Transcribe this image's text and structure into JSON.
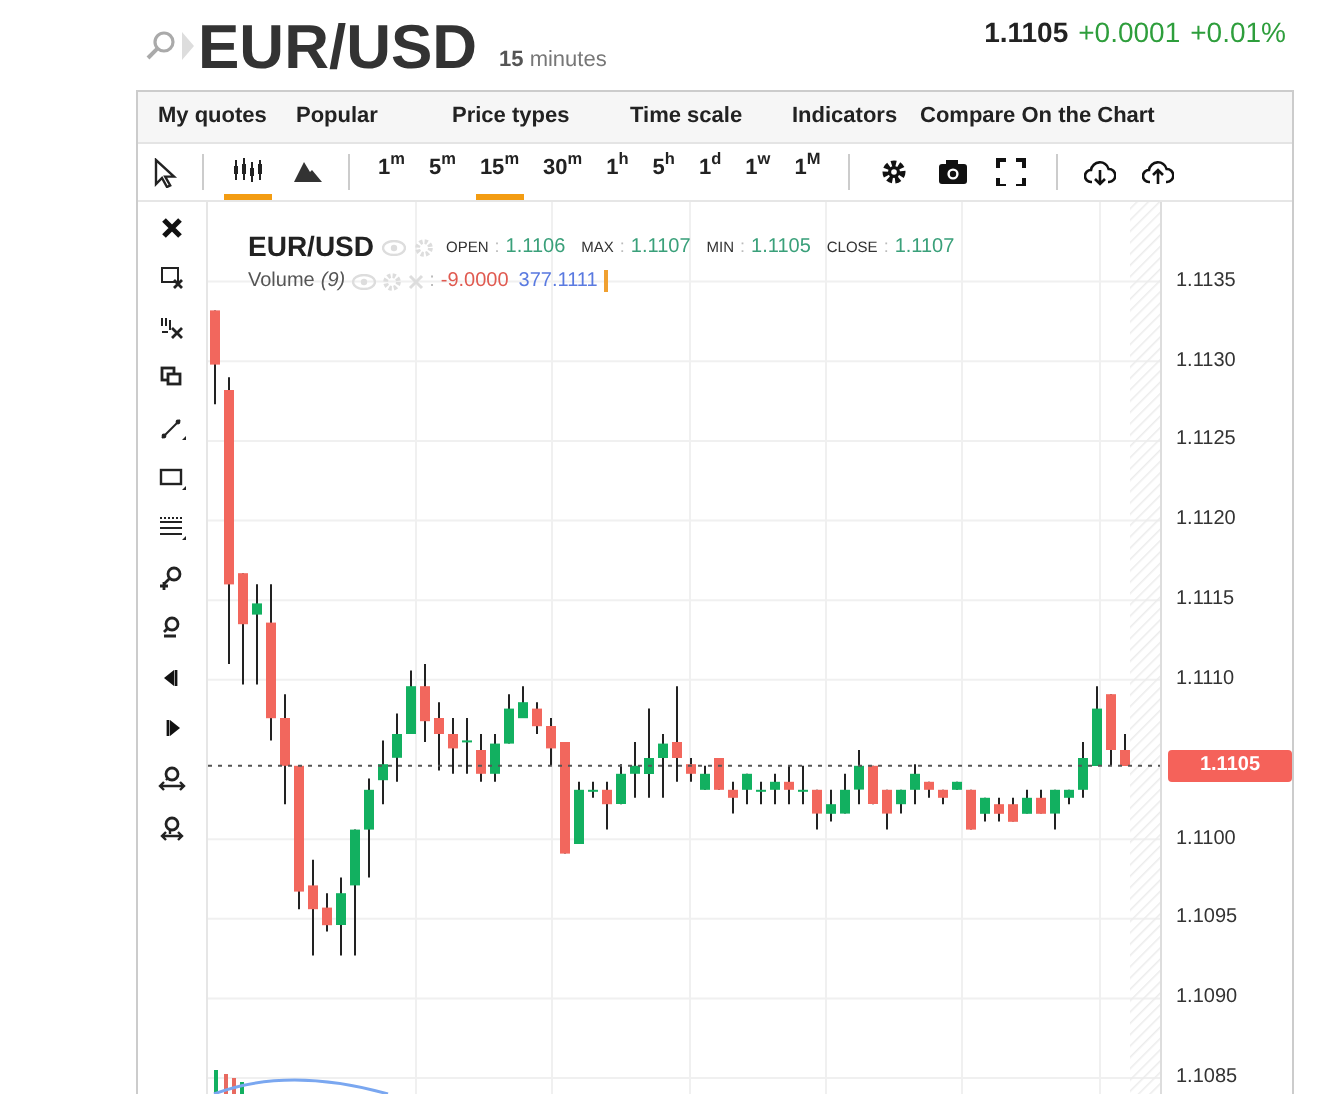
{
  "header": {
    "symbol": "EUR/USD",
    "interval_number": "15",
    "interval_unit": "minutes",
    "price": "1.1105",
    "change": "+0.0001",
    "change_percent": "+0.01%"
  },
  "menu": [
    "My quotes",
    "Popular",
    "Price types",
    "Time scale",
    "Indicators",
    "Compare On the Chart"
  ],
  "chart_types": [
    {
      "kind": "candles",
      "selected": true
    },
    {
      "kind": "area",
      "selected": false
    }
  ],
  "timeframes": [
    {
      "number": "1",
      "unit": "m",
      "selected": false
    },
    {
      "number": "5",
      "unit": "m",
      "selected": false
    },
    {
      "number": "15",
      "unit": "m",
      "selected": true
    },
    {
      "number": "30",
      "unit": "m",
      "selected": false
    },
    {
      "number": "1",
      "unit": "h",
      "selected": false
    },
    {
      "number": "5",
      "unit": "h",
      "selected": false
    },
    {
      "number": "1",
      "unit": "d",
      "selected": false
    },
    {
      "number": "1",
      "unit": "w",
      "selected": false
    },
    {
      "number": "1",
      "unit": "M",
      "selected": false
    }
  ],
  "legend": {
    "symbol": "EUR/USD",
    "fields": [
      {
        "label": "OPEN",
        "separator": ":",
        "value": "1.1106"
      },
      {
        "label": "MAX",
        "separator": ":",
        "value": "1.1107"
      },
      {
        "label": "MIN",
        "separator": ":",
        "value": "1.1105"
      },
      {
        "label": "CLOSE",
        "separator": ":",
        "value": "1.1107"
      }
    ],
    "volume": {
      "label": "Volume",
      "parameter": "(9)",
      "separator": ":",
      "value": "-9.0000",
      "value_2": "377.1111"
    }
  },
  "price_label": "1.1105",
  "chart_data": {
    "type": "candlestick",
    "ylim": [
      1.1084,
      1.114
    ],
    "yticks": [
      {
        "value": 1.1135,
        "label": "1.1135"
      },
      {
        "value": 1.113,
        "label": "1.1130"
      },
      {
        "value": 1.1125,
        "label": "1.1125"
      },
      {
        "value": 1.112,
        "label": "1.1120"
      },
      {
        "value": 1.1115,
        "label": "1.1115"
      },
      {
        "value": 1.111,
        "label": "1.1110"
      },
      {
        "value": 1.11,
        "label": "1.1100"
      },
      {
        "value": 1.1095,
        "label": "1.1095"
      },
      {
        "value": 1.109,
        "label": "1.1090"
      },
      {
        "value": 1.1085,
        "label": "1.1085"
      }
    ],
    "grid": true,
    "categories": [
      null,
      null,
      null,
      null,
      null,
      null,
      null,
      null,
      null,
      null,
      null,
      null,
      null,
      null,
      null,
      null,
      null,
      null,
      null,
      null,
      null,
      null,
      null,
      null,
      null,
      null,
      null,
      null,
      null,
      null,
      null,
      null,
      null,
      null,
      null,
      null,
      null,
      null,
      null,
      null,
      null,
      null,
      null,
      null,
      null,
      null,
      null,
      null,
      null,
      null,
      null,
      null,
      null,
      null,
      null,
      null,
      null,
      null,
      null,
      null,
      null,
      null,
      null,
      null,
      null,
      null
    ],
    "series": [
      {
        "ohlc": [
          [
            1.11332,
            1.11332,
            1.11273,
            1.11298
          ],
          [
            1.11282,
            1.1129,
            1.1111,
            1.1116
          ],
          [
            1.11167,
            1.11167,
            1.11097,
            1.11135
          ],
          [
            1.11141,
            1.1116,
            1.11097,
            1.11148
          ],
          [
            1.11136,
            1.1116,
            1.11062,
            1.11076
          ],
          [
            1.11076,
            1.11091,
            1.11022,
            1.11046
          ],
          [
            1.11046,
            1.11046,
            1.10956,
            1.10967
          ],
          [
            1.10971,
            1.10987,
            1.10927,
            1.10956
          ],
          [
            1.10957,
            1.10966,
            1.10942,
            1.10946
          ],
          [
            1.10946,
            1.10976,
            1.10927,
            1.10966
          ],
          [
            1.10971,
            1.11006,
            1.10927,
            1.11006
          ],
          [
            1.11006,
            1.11038,
            1.10976,
            1.11031
          ],
          [
            1.11037,
            1.11062,
            1.11022,
            1.11047
          ],
          [
            1.11051,
            1.11079,
            1.11036,
            1.11066
          ],
          [
            1.11066,
            1.11106,
            1.11066,
            1.11096
          ],
          [
            1.11096,
            1.1111,
            1.11061,
            1.11074
          ],
          [
            1.11076,
            1.11086,
            1.11043,
            1.11066
          ],
          [
            1.11066,
            1.11076,
            1.11041,
            1.11057
          ],
          [
            1.11062,
            1.11076,
            1.11041,
            1.11062
          ],
          [
            1.11056,
            1.11066,
            1.11036,
            1.11041
          ],
          [
            1.11041,
            1.11066,
            1.11036,
            1.1106
          ],
          [
            1.1106,
            1.11091,
            1.1106,
            1.11082
          ],
          [
            1.11076,
            1.11096,
            1.11076,
            1.11086
          ],
          [
            1.11082,
            1.11086,
            1.11066,
            1.11071
          ],
          [
            1.11071,
            1.11076,
            1.11046,
            1.11057
          ],
          [
            1.11061,
            1.11061,
            1.10991,
            1.10991
          ],
          [
            1.10997,
            1.11036,
            1.10997,
            1.11031
          ],
          [
            1.11031,
            1.11036,
            1.11026,
            1.11031
          ],
          [
            1.11031,
            1.11036,
            1.11006,
            1.11022
          ],
          [
            1.11022,
            1.11047,
            1.11022,
            1.11041
          ],
          [
            1.11041,
            1.11061,
            1.11026,
            1.11046
          ],
          [
            1.11041,
            1.11082,
            1.11026,
            1.11051
          ],
          [
            1.11051,
            1.11066,
            1.11026,
            1.1106
          ],
          [
            1.11061,
            1.11096,
            1.11036,
            1.11051
          ],
          [
            1.11047,
            1.11051,
            1.11036,
            1.11041
          ],
          [
            1.11031,
            1.11046,
            1.11031,
            1.11041
          ],
          [
            1.11051,
            1.11051,
            1.11031,
            1.11031
          ],
          [
            1.11031,
            1.11036,
            1.11016,
            1.11026
          ],
          [
            1.11031,
            1.11041,
            1.11022,
            1.11041
          ],
          [
            1.11031,
            1.11036,
            1.11022,
            1.11031
          ],
          [
            1.11031,
            1.11041,
            1.11022,
            1.11036
          ],
          [
            1.11036,
            1.11046,
            1.11022,
            1.11031
          ],
          [
            1.11031,
            1.11046,
            1.11022,
            1.11031
          ],
          [
            1.11031,
            1.11031,
            1.11006,
            1.11016
          ],
          [
            1.11016,
            1.11031,
            1.11011,
            1.11022
          ],
          [
            1.11016,
            1.11041,
            1.11016,
            1.11031
          ],
          [
            1.11031,
            1.11056,
            1.11022,
            1.11046
          ],
          [
            1.11046,
            1.11046,
            1.11022,
            1.11022
          ],
          [
            1.11031,
            1.11031,
            1.11006,
            1.11016
          ],
          [
            1.11022,
            1.11031,
            1.11016,
            1.11031
          ],
          [
            1.11031,
            1.11047,
            1.11022,
            1.11041
          ],
          [
            1.11036,
            1.11036,
            1.11026,
            1.11031
          ],
          [
            1.11031,
            1.11031,
            1.11022,
            1.11026
          ],
          [
            1.11031,
            1.11036,
            1.11031,
            1.11036
          ],
          [
            1.11031,
            1.11031,
            1.11006,
            1.11006
          ],
          [
            1.11016,
            1.11026,
            1.11011,
            1.11026
          ],
          [
            1.11022,
            1.11026,
            1.11011,
            1.11016
          ],
          [
            1.11022,
            1.11026,
            1.11011,
            1.11011
          ],
          [
            1.11016,
            1.11031,
            1.11016,
            1.11026
          ],
          [
            1.11026,
            1.11031,
            1.11016,
            1.11016
          ],
          [
            1.11016,
            1.11031,
            1.11006,
            1.11031
          ],
          [
            1.11026,
            1.11031,
            1.11022,
            1.11031
          ],
          [
            1.11031,
            1.11061,
            1.11026,
            1.11051
          ],
          [
            1.11046,
            1.11096,
            1.11046,
            1.11082
          ],
          [
            1.11091,
            1.11091,
            1.11046,
            1.11056
          ],
          [
            1.11056,
            1.11066,
            1.11046,
            1.11046
          ]
        ]
      }
    ]
  }
}
